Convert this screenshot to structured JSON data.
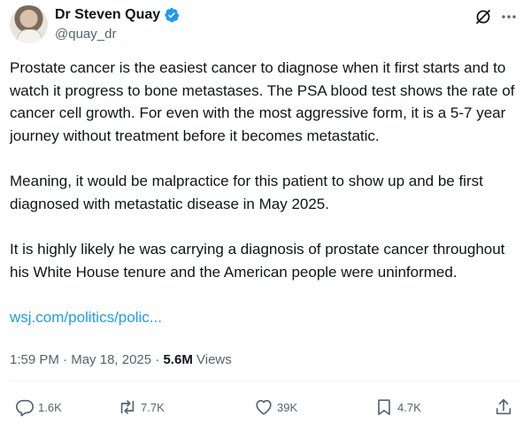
{
  "author": {
    "display_name": "Dr Steven Quay",
    "handle": "@quay_dr",
    "verified": true
  },
  "tweet": {
    "paragraphs": [
      "Prostate cancer is the easiest cancer to diagnose when it first starts and to watch it progress to bone metastases. The PSA blood test shows the rate of cancer cell growth. For even with the most aggressive form, it is a 5-7 year journey without treatment before it becomes metastatic.",
      "Meaning, it would be malpractice for this patient to show up and be first diagnosed with metastatic disease in May 2025.",
      "It is highly likely he was carrying a diagnosis of prostate cancer throughout his White House tenure and the American people were uninformed."
    ],
    "link_text": "wsj.com/politics/polic..."
  },
  "meta": {
    "time": "1:59 PM",
    "separator": " · ",
    "date": "May 18, 2025",
    "views_count": "5.6M",
    "views_label": "Views"
  },
  "actions": {
    "replies": "1.6K",
    "reposts": "7.7K",
    "likes": "39K",
    "bookmarks": "4.7K"
  },
  "icons": {
    "verified": "verified-badge-icon",
    "grok": "grok-icon",
    "more": "more-icon",
    "reply": "reply-icon",
    "repost": "repost-icon",
    "like": "heart-icon",
    "bookmark": "bookmark-icon",
    "share": "share-icon"
  },
  "colors": {
    "link": "#1d9bf0",
    "verified": "#1d9bf0",
    "muted": "#536471",
    "text": "#0f1419"
  }
}
